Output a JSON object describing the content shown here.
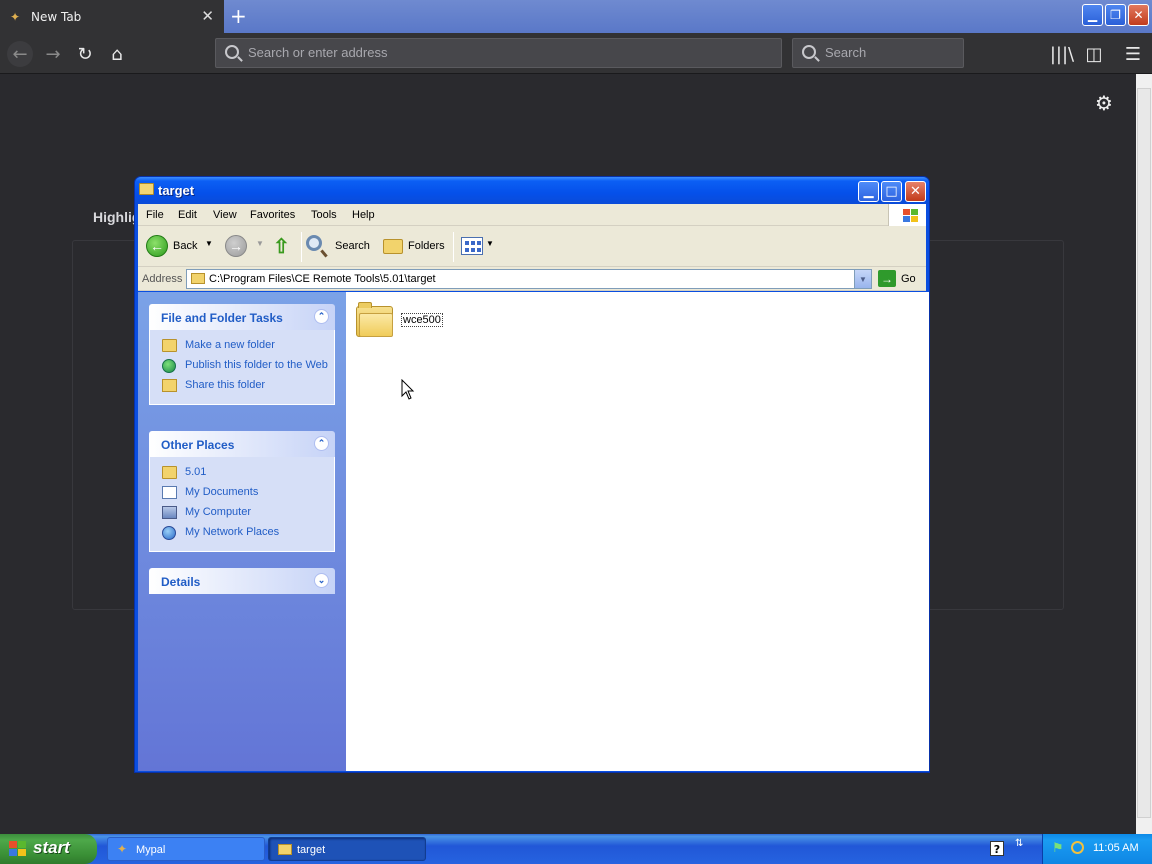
{
  "browser": {
    "tab_title": "New Tab",
    "tab_close": "✕",
    "new_tab": "+",
    "url_placeholder": "Search or enter address",
    "search_placeholder": "Search",
    "highlights_label": "Highlig",
    "window_buttons": {
      "minimize": "▁",
      "restore": "❐",
      "close": "✕"
    }
  },
  "explorer": {
    "title": "target",
    "menu": [
      "File",
      "Edit",
      "View",
      "Favorites",
      "Tools",
      "Help"
    ],
    "toolbar": {
      "back": "Back",
      "search": "Search",
      "folders": "Folders"
    },
    "address": {
      "label": "Address",
      "path": "C:\\Program Files\\CE Remote Tools\\5.01\\target",
      "go": "Go"
    },
    "task_pane": {
      "file_tasks": {
        "title": "File and Folder Tasks",
        "items": [
          "Make a new folder",
          "Publish this folder to the Web",
          "Share this folder"
        ]
      },
      "other_places": {
        "title": "Other Places",
        "items": [
          "5.01",
          "My Documents",
          "My Computer",
          "My Network Places"
        ]
      },
      "details": {
        "title": "Details"
      }
    },
    "items": [
      {
        "name": "wce500",
        "type": "folder"
      }
    ]
  },
  "taskbar": {
    "start": "start",
    "buttons": [
      "Mypal",
      "target"
    ],
    "clock": "11:05 AM",
    "help_icon": "?"
  },
  "colors": {
    "xp_blue": "#0a4ee0",
    "task_link": "#215dc6",
    "browser_bg": "#2a2a2e"
  }
}
